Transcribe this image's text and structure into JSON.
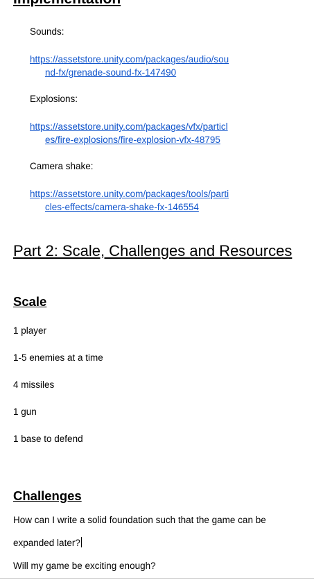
{
  "doc": {
    "cut_heading": "Implementation",
    "sounds_label": "Sounds:",
    "sounds_link": [
      "https://assetstore.unity.com/packages/audio/sou",
      "nd-fx/grenade-sound-fx-147490"
    ],
    "explosions_label": "Explosions:",
    "explosions_link": [
      "https://assetstore.unity.com/packages/vfx/particl",
      "es/fire-explosions/fire-explosion-vfx-48795"
    ],
    "camera_label": "Camera shake:",
    "camera_link": [
      "https://assetstore.unity.com/packages/tools/parti",
      "cles-effects/camera-shake-fx-146554"
    ],
    "part2_heading": "Part 2: Scale, Challenges and Resources",
    "scale_heading": "Scale",
    "scale_items": [
      "1 player",
      "1-5 enemies at a time",
      "4 missiles",
      "1 gun",
      "1 base to defend"
    ],
    "challenges_heading": "Challenges",
    "challenges_lines": [
      "How can I write a solid foundation such that the game can be",
      "expanded later?",
      "Will my game be exciting enough?"
    ]
  }
}
